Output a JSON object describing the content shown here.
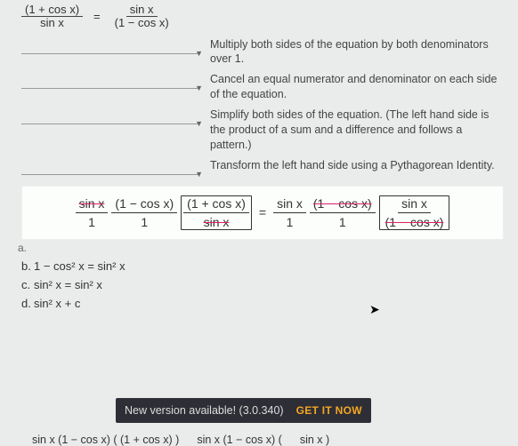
{
  "top": {
    "lhs_num": "(1 + cos x)",
    "lhs_den": "sin x",
    "eq": "=",
    "rhs_num": "sin x",
    "rhs_den": "(1 − cos x)"
  },
  "steps": [
    "Multiply both sides of the equation by both denominators over 1.",
    "Cancel an equal numerator and denominator on each side of the equation.",
    "Simplify both sides of the equation. (The left hand side is the product of a sum and a difference and follows a pattern.)",
    "Transform the left hand side using a Pythagorean Identity."
  ],
  "panel_eq": {
    "l1t": "sin x",
    "l1b": "1",
    "l2t": "(1 − cos x)",
    "l2b": "1",
    "l3t": "(1 + cos x)",
    "l3b": "sin x",
    "eq": "=",
    "r1t": "sin x",
    "r1b": "1",
    "r2t": "(1 − cos x)",
    "r2b": "1",
    "r3t": "sin x",
    "r3b": "(1 − cos x)"
  },
  "a_label": "a.",
  "choices": {
    "b": "1 − cos² x = sin² x",
    "c": "sin² x = sin² x",
    "d_prefix": "sin² x + c"
  },
  "toast": {
    "msg": "New version available! (3.0.340)",
    "cta": "GET IT NOW"
  },
  "bottom": {
    "c1": "sin x  (1 − cos x)  ( (1 + cos x) )",
    "c2": "sin x  (1 − cos x)  (",
    "c3": "sin x   )"
  }
}
